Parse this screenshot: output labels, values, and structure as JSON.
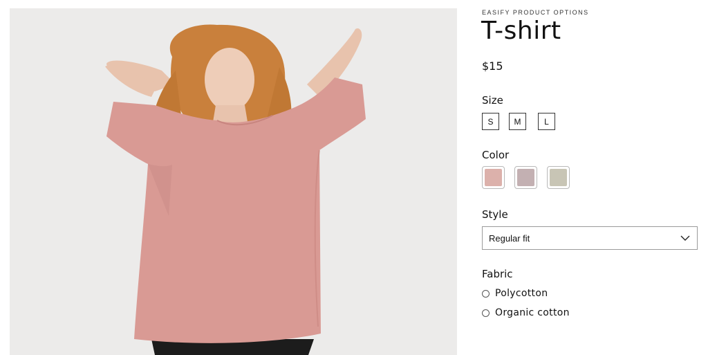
{
  "product": {
    "vendor": "EASIFY PRODUCT OPTIONS",
    "title": "T-shirt",
    "price": "$15",
    "image_alt": "woman-in-pink-oversized-tshirt"
  },
  "options": {
    "size": {
      "label": "Size",
      "values": [
        "S",
        "M",
        "L"
      ]
    },
    "color": {
      "label": "Color",
      "swatches": [
        "#dcb1ab",
        "#c3b0b2",
        "#c8c5b5"
      ]
    },
    "style": {
      "label": "Style",
      "selected": "Regular fit"
    },
    "fabric": {
      "label": "Fabric",
      "choices": [
        "Polycotton",
        "Organic cotton"
      ]
    }
  },
  "icons": {
    "dropdown": "chevron-down-icon",
    "radio": "radio-unchecked-icon"
  }
}
